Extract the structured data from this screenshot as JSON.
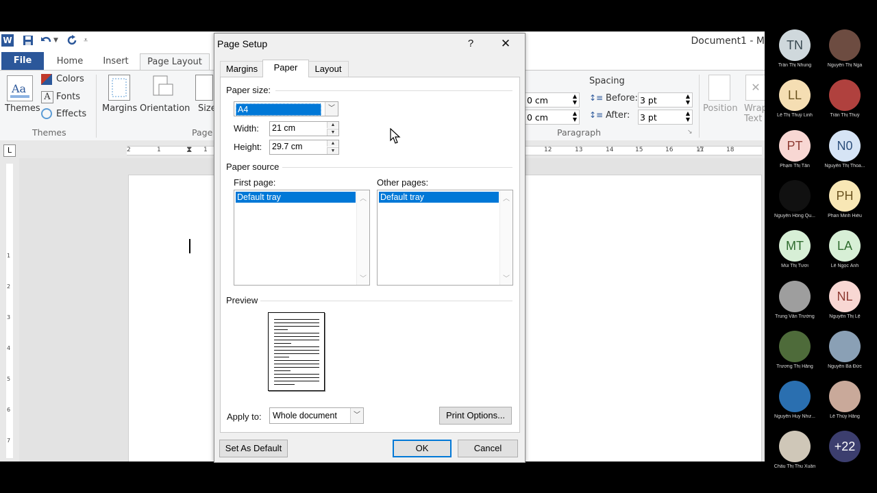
{
  "word": {
    "doc_title": "Document1 - M",
    "tabs": [
      "File",
      "Home",
      "Insert",
      "Page Layout"
    ],
    "themes": {
      "themes_label": "Themes",
      "colors": "Colors",
      "fonts": "Fonts",
      "effects": "Effects",
      "group": "Themes"
    },
    "page_setup": {
      "margins": "Margins",
      "orientation": "Orientation",
      "size": "Size",
      "group": "Page"
    },
    "paragraph": {
      "indent_left": "0 cm",
      "indent_right": "0 cm",
      "spacing_title": "Spacing",
      "before_label": "Before:",
      "before_val": "3 pt",
      "after_label": "After:",
      "after_val": "3 pt",
      "group": "Paragraph"
    },
    "arrange": {
      "position": "Position",
      "wrap": "Wrap",
      "text": "Text"
    },
    "ruler_left": [
      "2",
      "1",
      "1"
    ],
    "ruler_right": [
      "12",
      "13",
      "14",
      "15",
      "16",
      "17",
      "18"
    ],
    "vruler": [
      "1",
      "2",
      "3",
      "4",
      "5",
      "6",
      "7"
    ]
  },
  "dialog": {
    "title": "Page Setup",
    "help": "?",
    "close": "✕",
    "tabs": [
      "Margins",
      "Paper",
      "Layout"
    ],
    "paper_size_label": "Paper size:",
    "paper_size_value": "A4",
    "width_label": "Width:",
    "width_value": "21 cm",
    "height_label": "Height:",
    "height_value": "29.7 cm",
    "paper_source_label": "Paper source",
    "first_page_label": "First page:",
    "first_page_item": "Default tray",
    "other_pages_label": "Other pages:",
    "other_pages_item": "Default tray",
    "preview_label": "Preview",
    "apply_to_label": "Apply to:",
    "apply_to_value": "Whole document",
    "print_options": "Print Options...",
    "set_default": "Set As Default",
    "ok": "OK",
    "cancel": "Cancel"
  },
  "participants": [
    {
      "initials": "TN",
      "name": "Trần Thị Nhung",
      "color": "#cfd8dc",
      "fg": "#37474f"
    },
    {
      "initials": "",
      "name": "Nguyễn Thị Nga",
      "color": "#6d4c41",
      "fg": "#fff"
    },
    {
      "initials": "LL",
      "name": "Lê Thị Thuỳ Linh",
      "color": "#f5deb3",
      "fg": "#6b5320"
    },
    {
      "initials": "",
      "name": "Trần Thị Thuỷ",
      "color": "#b0413e",
      "fg": "#fff"
    },
    {
      "initials": "PT",
      "name": "Phạm Thị Tân",
      "color": "#f8d7d3",
      "fg": "#8e3b33"
    },
    {
      "initials": "N0",
      "name": "Nguyễn Thị Thoa...",
      "color": "#d6e4f5",
      "fg": "#2d4f7c"
    },
    {
      "initials": "",
      "name": "Nguyễn Hồng Qu...",
      "color": "#111",
      "fg": "#fff"
    },
    {
      "initials": "PH",
      "name": "Phan Minh Hiếu",
      "color": "#f8e7b5",
      "fg": "#6b5320"
    },
    {
      "initials": "MT",
      "name": "Mùi Thị Tươi",
      "color": "#d7efd6",
      "fg": "#2f6b2e"
    },
    {
      "initials": "LA",
      "name": "Lê Ngọc Ánh",
      "color": "#d7efd6",
      "fg": "#2f6b2e"
    },
    {
      "initials": "",
      "name": "Trung Văn Trường",
      "color": "#9e9e9e",
      "fg": "#fff"
    },
    {
      "initials": "NL",
      "name": "Nguyễn Thị Lệ",
      "color": "#f8d7d3",
      "fg": "#8e3b33"
    },
    {
      "initials": "",
      "name": "Trương Thị Hằng",
      "color": "#4e6b3a",
      "fg": "#fff"
    },
    {
      "initials": "",
      "name": "Nguyễn Bá Đức",
      "color": "#8aa0b5",
      "fg": "#fff"
    },
    {
      "initials": "",
      "name": "Nguyễn Huy Như...",
      "color": "#2a6fb0",
      "fg": "#fff"
    },
    {
      "initials": "",
      "name": "Lê Thùy Hằng",
      "color": "#c9a99a",
      "fg": "#fff"
    },
    {
      "initials": "",
      "name": "Chẩu Thị Thu Xuân",
      "color": "#cfc7b8",
      "fg": "#fff"
    },
    {
      "initials": "+22",
      "name": "",
      "color": "#3c3e6e",
      "fg": "#fff"
    }
  ]
}
